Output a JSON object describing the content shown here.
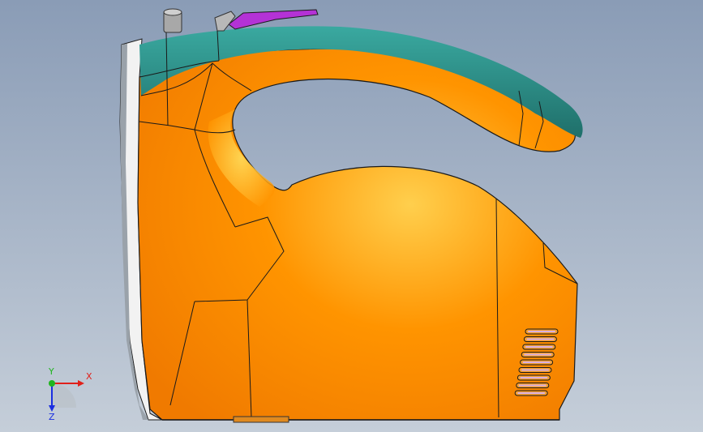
{
  "viewport": {
    "background_top": "#8a9cb6",
    "background_bottom": "#c5ced9"
  },
  "model": {
    "body_color": "#ff9400",
    "body_highlight": "#ffcf4d",
    "handle_grip_color": "#2a8f88",
    "button_color": "#b432d6",
    "side_panel_color": "#f2f2f2",
    "edge_color": "#1a1a1a"
  },
  "triad": {
    "x_label": "X",
    "y_label": "Y",
    "z_label": "Z",
    "x_color": "#e0201a",
    "y_color": "#1fb51f",
    "z_color": "#1a2ee0"
  }
}
